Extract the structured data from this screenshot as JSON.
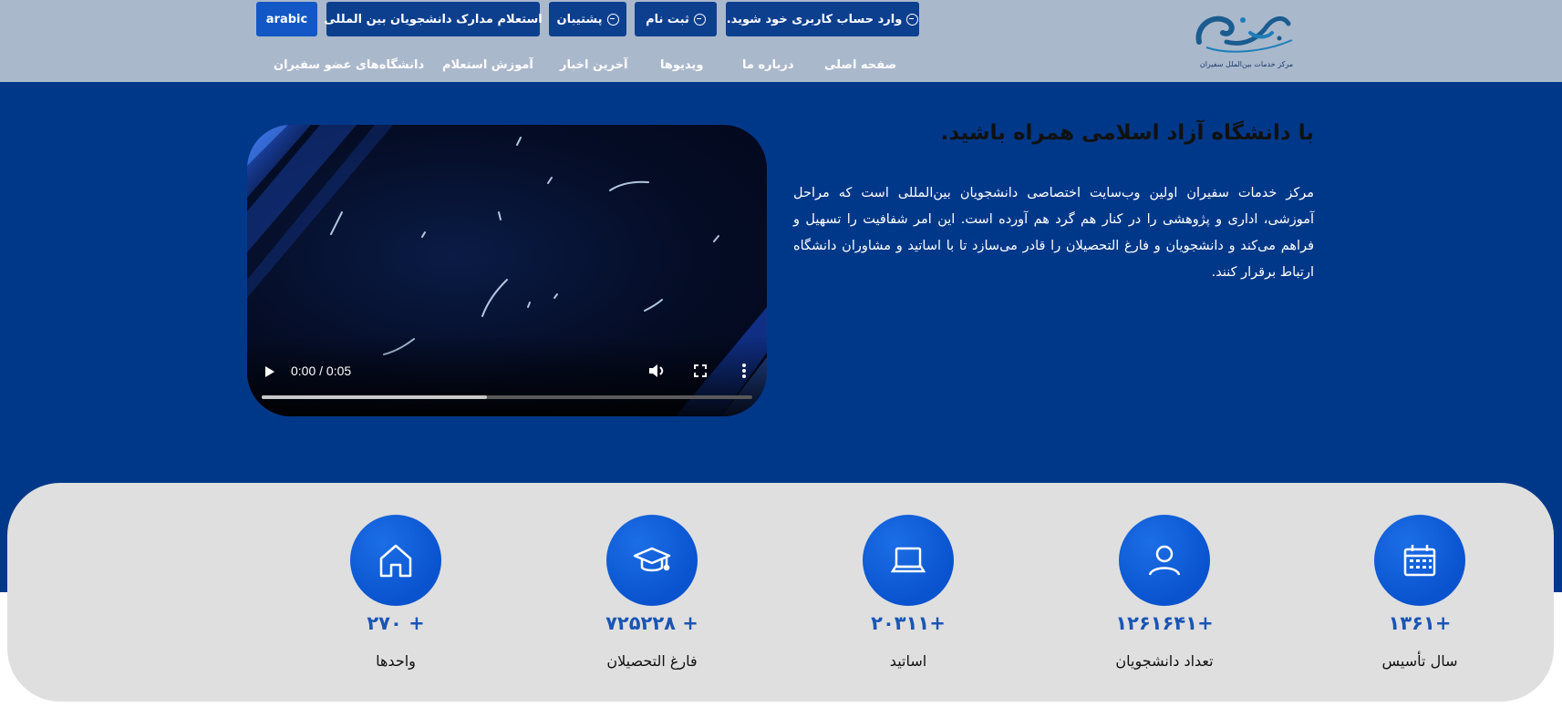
{
  "header": {
    "buttons": {
      "login": "وارد حساب کاربری خود شوید.",
      "register": "ثبت نام",
      "support": "پشتیبان",
      "inquiry": "استعلام مدارک دانشجویان بین المللی",
      "arabic": "arabic"
    },
    "nav": {
      "home": "صفحه اصلی",
      "about": "درباره ما",
      "videos": "ویدیوها",
      "news": "آخرین اخبار",
      "tutorial": "آموزش استعلام",
      "universities": "دانشگاه‌های عضو سفیران"
    },
    "logo": {
      "main": "سفیران",
      "sub": "مرکز خدمات بین‌الملل سفیران"
    }
  },
  "hero": {
    "title": "با دانشگاه آزاد اسلامی همراه باشید.",
    "description": "مرکز خدمات سفیران اولین وب‌سایت اختصاصی دانشجویان بین‌المللی است که مراحل آموزشی، اداری و پژوهشی را در کنار هم گرد هم آورده است. این امر شفافیت را تسهیل و فراهم می‌کند و دانشجویان و فارغ التحصیلان را قادر می‌سازد تا با اساتید و مشاوران دانشگاه ارتباط برقرار کنند."
  },
  "video": {
    "time": "0:00 / 0:05",
    "progress": 0.46
  },
  "stats": [
    {
      "icon": "calendar-icon",
      "number": "+۱۳۶۱",
      "label": "سال تأسیس"
    },
    {
      "icon": "user-icon",
      "number": "+۱۲۶۱۶۴۱",
      "label": "تعداد دانشجویان"
    },
    {
      "icon": "laptop-icon",
      "number": "+۲۰۳۱۱",
      "label": "اساتید"
    },
    {
      "icon": "graduation-cap-icon",
      "number": "+ ۷۲۵۲۲۸",
      "label": "فارغ التحصیلان"
    },
    {
      "icon": "home-icon",
      "number": "+ ۲۷۰",
      "label": "واحدها"
    }
  ],
  "colors": {
    "header_bg": "#aab8cc",
    "hero_bg": "#003889",
    "button_bg": "#0d3f8f",
    "accent": "#0953cf",
    "stats_bg": "#dfdfdf",
    "stat_number": "#1a55b5"
  }
}
